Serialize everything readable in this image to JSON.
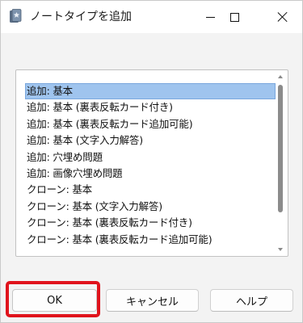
{
  "window": {
    "title": "ノートタイプを追加",
    "icon": "anki-app-icon",
    "controls": [
      "minimize-icon",
      "maximize-icon",
      "close-icon"
    ]
  },
  "note_types": {
    "selected_index": 0,
    "items": [
      "追加: 基本",
      "追加: 基本 (裏表反転カード付き)",
      "追加: 基本 (裏表反転カード追加可能)",
      "追加: 基本 (文字入力解答)",
      "追加: 穴埋め問題",
      "追加: 画像穴埋め問題",
      "クローン: 基本",
      "クローン: 基本 (文字入力解答)",
      "クローン: 基本 (裏表反転カード付き)",
      "クローン: 基本 (裏表反転カード追加可能)"
    ],
    "selection_color": "#9fc4ee"
  },
  "buttons": {
    "ok_label": "OK",
    "cancel_label": "キャンセル",
    "help_label": "ヘルプ"
  },
  "annotation": {
    "highlight_color": "#e0131c",
    "highlighted": "ok-button"
  }
}
